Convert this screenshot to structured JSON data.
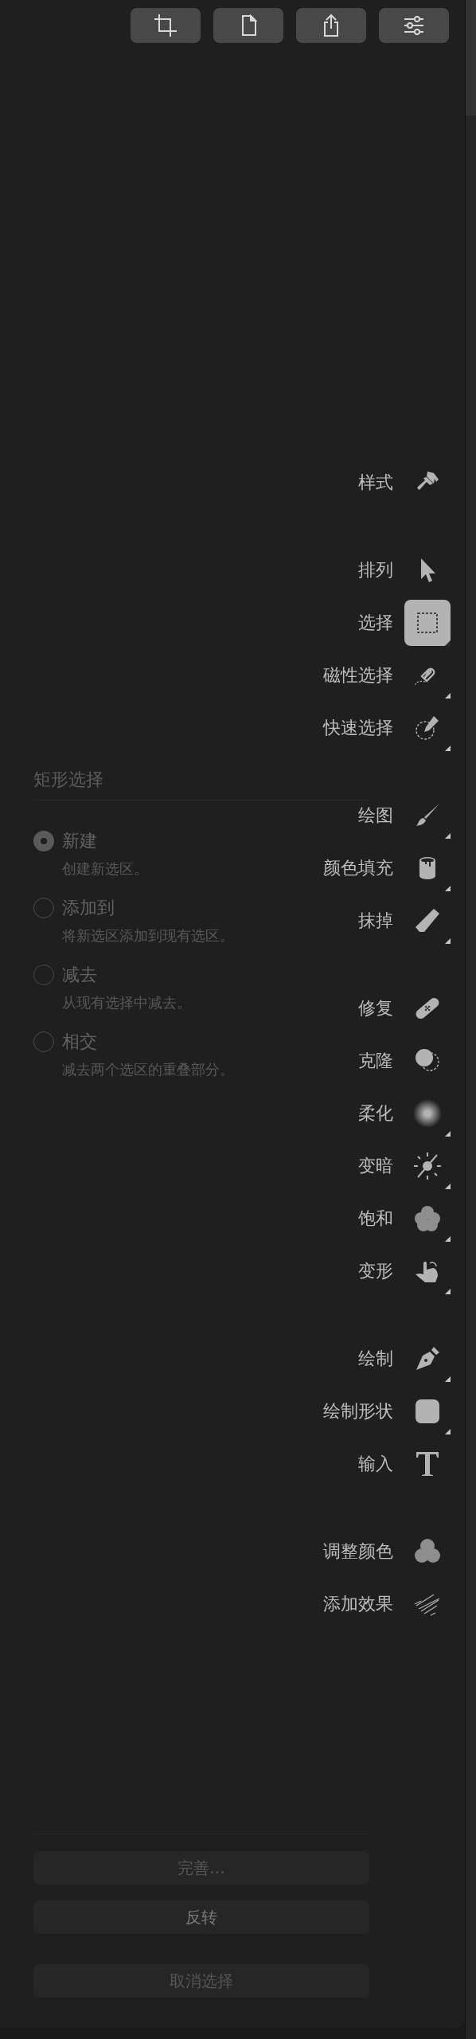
{
  "toolbar": [
    {
      "kind": "crop"
    },
    {
      "kind": "document"
    },
    {
      "kind": "share"
    },
    {
      "kind": "adjust"
    }
  ],
  "panel": {
    "title": "矩形选择",
    "options": [
      {
        "label": "新建",
        "description": "创建新选区。",
        "selected": true
      },
      {
        "label": "添加到",
        "description": "将新选区添加到现有选区。",
        "selected": false
      },
      {
        "label": "减去",
        "description": "从现有选择中减去。",
        "selected": false
      },
      {
        "label": "相交",
        "description": "减去两个选区的重叠部分。",
        "selected": false
      }
    ],
    "buttons": [
      {
        "label": "完善…",
        "disabled": true
      },
      {
        "label": "反转",
        "disabled": false
      },
      {
        "label": "取消选择",
        "disabled": true
      }
    ]
  },
  "tools": [
    [
      {
        "label": "样式",
        "kind": "style",
        "selected": false,
        "has_menu": false
      }
    ],
    [
      {
        "label": "排列",
        "kind": "arrange",
        "selected": false,
        "has_menu": false
      },
      {
        "label": "选择",
        "kind": "select",
        "selected": true,
        "has_menu": true
      },
      {
        "label": "磁性选择",
        "kind": "magnetic",
        "selected": false,
        "has_menu": true
      },
      {
        "label": "快速选择",
        "kind": "quick",
        "selected": false,
        "has_menu": true
      }
    ],
    [
      {
        "label": "绘图",
        "kind": "paint",
        "selected": false,
        "has_menu": true
      },
      {
        "label": "颜色填充",
        "kind": "fill",
        "selected": false,
        "has_menu": true
      },
      {
        "label": "抹掉",
        "kind": "erase",
        "selected": false,
        "has_menu": true
      }
    ],
    [
      {
        "label": "修复",
        "kind": "repair",
        "selected": false,
        "has_menu": false
      },
      {
        "label": "克隆",
        "kind": "clone",
        "selected": false,
        "has_menu": false
      },
      {
        "label": "柔化",
        "kind": "soften",
        "selected": false,
        "has_menu": true
      },
      {
        "label": "变暗",
        "kind": "darken",
        "selected": false,
        "has_menu": true
      },
      {
        "label": "饱和",
        "kind": "saturate",
        "selected": false,
        "has_menu": true
      },
      {
        "label": "变形",
        "kind": "warp",
        "selected": false,
        "has_menu": true
      }
    ],
    [
      {
        "label": "绘制",
        "kind": "pen",
        "selected": false,
        "has_menu": true
      },
      {
        "label": "绘制形状",
        "kind": "shape",
        "selected": false,
        "has_menu": true
      },
      {
        "label": "输入",
        "kind": "type",
        "selected": false,
        "has_menu": false
      }
    ],
    [
      {
        "label": "调整颜色",
        "kind": "colors",
        "selected": false,
        "has_menu": false
      },
      {
        "label": "添加效果",
        "kind": "effects",
        "selected": false,
        "has_menu": false
      }
    ]
  ]
}
